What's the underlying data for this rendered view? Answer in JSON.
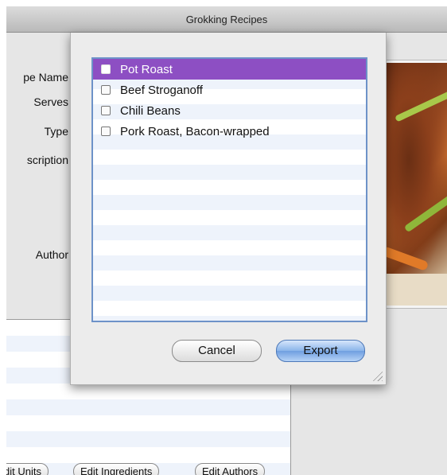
{
  "window": {
    "title": "Grokking Recipes"
  },
  "form_labels": [
    "pe Name",
    "Serves",
    "Type",
    "scription",
    "Author"
  ],
  "bottom_buttons": [
    "dit Units",
    "Edit Ingredients",
    "Edit Authors"
  ],
  "export_sheet": {
    "recipes": [
      {
        "label": "Pot Roast",
        "selected": true
      },
      {
        "label": "Beef Stroganoff",
        "selected": false
      },
      {
        "label": "Chili Beans",
        "selected": false
      },
      {
        "label": "Pork Roast, Bacon-wrapped",
        "selected": false
      }
    ],
    "cancel_label": "Cancel",
    "export_label": "Export"
  },
  "colors": {
    "selection": "#8d4fc3",
    "default_button": "#6f9fe0",
    "list_stripe": "#eef3fb"
  }
}
